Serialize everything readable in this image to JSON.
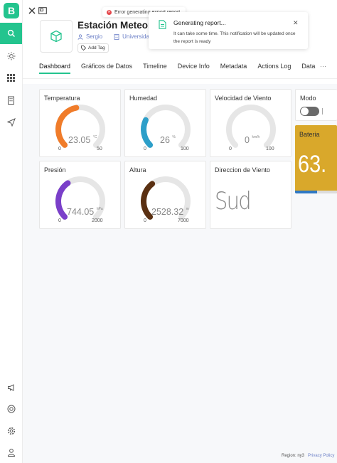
{
  "app": {
    "logo_letter": "B"
  },
  "device": {
    "title": "Estación Meteorológica",
    "owner": "Sergio",
    "organization": "Universidad Católica B",
    "add_tag": "Add Tag"
  },
  "tabs": [
    "Dashboard",
    "Gráficos de Datos",
    "Timeline",
    "Device Info",
    "Metadata",
    "Actions Log",
    "Data"
  ],
  "active_tab": "Dashboard",
  "toasts": {
    "error": "Error generating export report",
    "notification": {
      "title": "Generating report...",
      "body": "It can take some time. This notification will be updated once the report is ready"
    }
  },
  "widgets": {
    "temperatura": {
      "title": "Temperatura",
      "value": "23.05",
      "unit": "°C",
      "min": "0",
      "max": "50",
      "fraction": 0.461,
      "color": "#f07c2a"
    },
    "humedad": {
      "title": "Humedad",
      "value": "26",
      "unit": "%",
      "min": "0",
      "max": "100",
      "fraction": 0.26,
      "color": "#2d9fc9"
    },
    "viento": {
      "title": "Velocidad de Viento",
      "value": "0",
      "unit": "km/h",
      "min": "0",
      "max": "100",
      "fraction": 0,
      "color": "#2d9fc9"
    },
    "modo": {
      "title": "Modo"
    },
    "presion": {
      "title": "Presión",
      "value": "744.05",
      "unit": "hPa",
      "min": "0",
      "max": "2000",
      "fraction": 0.372,
      "color": "#7a3fc9"
    },
    "altura": {
      "title": "Altura",
      "value": "2528.32",
      "unit": "m",
      "min": "0",
      "max": "7000",
      "fraction": 0.361,
      "color": "#5a3012"
    },
    "direccion": {
      "title": "Direccion de Viento",
      "value": "Sud"
    },
    "bateria": {
      "title": "Bateria",
      "value": "63.",
      "fraction": 0.52
    }
  },
  "footer": {
    "region": "Region: ny3",
    "privacy": "Privacy Policy"
  },
  "colors": {
    "accent": "#23c48e",
    "link": "#6b7fc7",
    "battery_bg": "#d9a82b"
  },
  "icons": [
    "search-icon",
    "sun-icon",
    "grid-icon",
    "building-icon",
    "send-icon",
    "megaphone-icon",
    "help-icon",
    "settings-icon",
    "user-icon",
    "close-icon",
    "fullscreen-icon",
    "cube-icon",
    "tag-icon",
    "file-icon"
  ]
}
